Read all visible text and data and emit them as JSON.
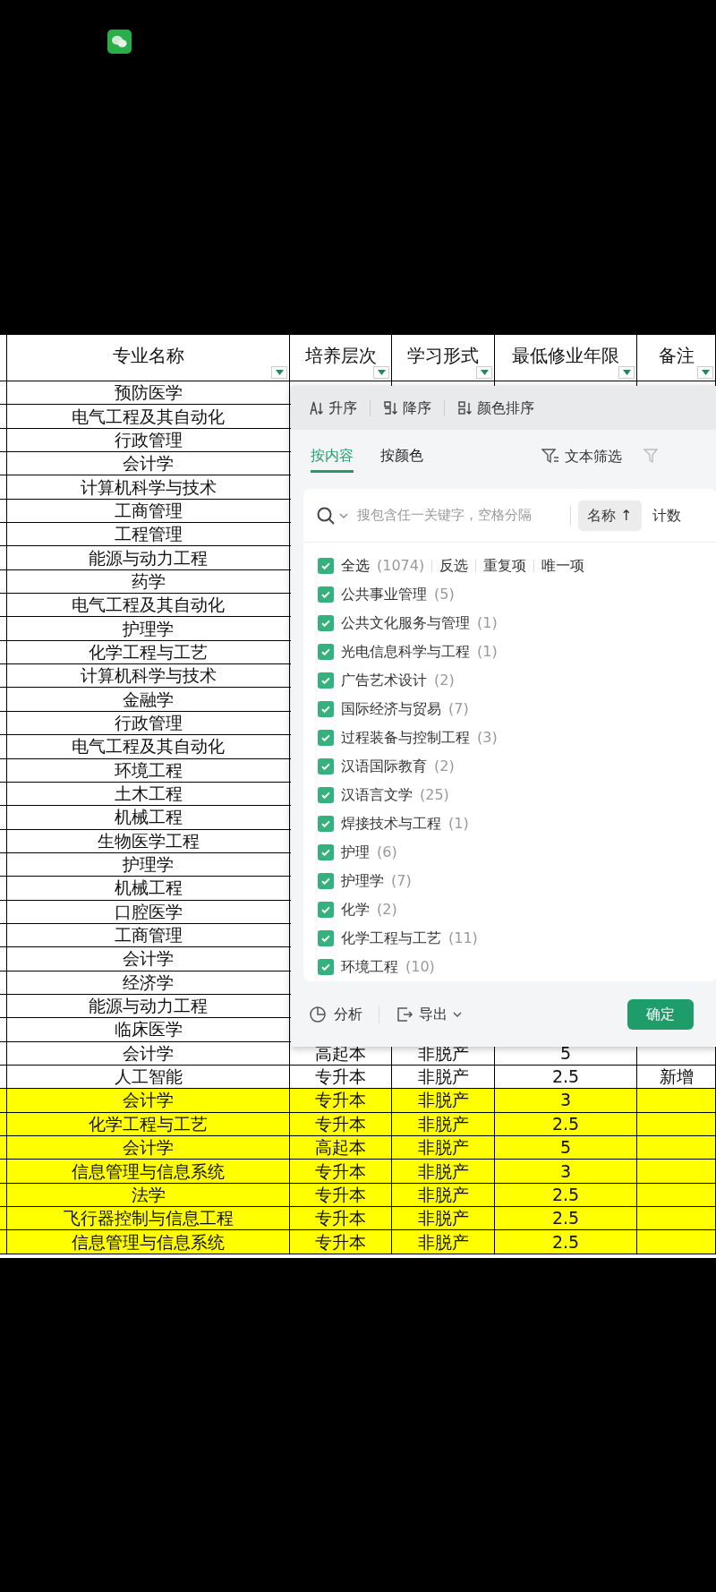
{
  "table": {
    "columns": [
      {
        "label": "专业名称"
      },
      {
        "label": "培养层次"
      },
      {
        "label": "学习形式"
      },
      {
        "label": "最低修业年限"
      },
      {
        "label": "备注"
      }
    ],
    "rows": [
      {
        "name": "预防医学",
        "highlighted": false
      },
      {
        "name": "电气工程及其自动化",
        "highlighted": false
      },
      {
        "name": "行政管理",
        "highlighted": false
      },
      {
        "name": "会计学",
        "highlighted": false
      },
      {
        "name": "计算机科学与技术",
        "highlighted": false
      },
      {
        "name": "工商管理",
        "highlighted": false
      },
      {
        "name": "工程管理",
        "highlighted": false
      },
      {
        "name": "能源与动力工程",
        "highlighted": false
      },
      {
        "name": "药学",
        "highlighted": false
      },
      {
        "name": "电气工程及其自动化",
        "highlighted": false
      },
      {
        "name": "护理学",
        "highlighted": false
      },
      {
        "name": "化学工程与工艺",
        "highlighted": false
      },
      {
        "name": "计算机科学与技术",
        "highlighted": false
      },
      {
        "name": "金融学",
        "highlighted": false
      },
      {
        "name": "行政管理",
        "highlighted": false
      },
      {
        "name": "电气工程及其自动化",
        "highlighted": false
      },
      {
        "name": "环境工程",
        "highlighted": false
      },
      {
        "name": "土木工程",
        "highlighted": false
      },
      {
        "name": "机械工程",
        "highlighted": false
      },
      {
        "name": "生物医学工程",
        "highlighted": false
      },
      {
        "name": "护理学",
        "highlighted": false
      },
      {
        "name": "机械工程",
        "highlighted": false
      },
      {
        "name": "口腔医学",
        "highlighted": false
      },
      {
        "name": "工商管理",
        "highlighted": false
      },
      {
        "name": "会计学",
        "highlighted": false
      },
      {
        "name": "经济学",
        "highlighted": false
      },
      {
        "name": "能源与动力工程",
        "highlighted": false
      },
      {
        "name": "临床医学",
        "highlighted": false
      },
      {
        "name": "会计学",
        "level": "高起本",
        "form": "非脱产",
        "years": "5",
        "highlighted": false
      },
      {
        "name": "人工智能",
        "level": "专升本",
        "form": "非脱产",
        "years": "2.5",
        "note": "新增",
        "highlighted": false
      },
      {
        "name": "会计学",
        "level": "专升本",
        "form": "非脱产",
        "years": "3",
        "highlighted": true
      },
      {
        "name": "化学工程与工艺",
        "level": "专升本",
        "form": "非脱产",
        "years": "2.5",
        "highlighted": true
      },
      {
        "name": "会计学",
        "level": "高起本",
        "form": "非脱产",
        "years": "5",
        "highlighted": true
      },
      {
        "name": "信息管理与信息系统",
        "level": "专升本",
        "form": "非脱产",
        "years": "3",
        "highlighted": true
      },
      {
        "name": "法学",
        "level": "专升本",
        "form": "非脱产",
        "years": "2.5",
        "highlighted": true
      },
      {
        "name": "飞行器控制与信息工程",
        "level": "专升本",
        "form": "非脱产",
        "years": "2.5",
        "highlighted": true
      },
      {
        "name": "信息管理与信息系统",
        "level": "专升本",
        "form": "非脱产",
        "years": "2.5",
        "highlighted": true
      }
    ]
  },
  "filter_popup": {
    "sort_buttons": [
      {
        "label": "升序",
        "kind": "asc"
      },
      {
        "label": "降序",
        "kind": "desc"
      },
      {
        "label": "颜色排序",
        "kind": "color"
      }
    ],
    "tabs": [
      {
        "label": "按内容",
        "selected": true
      },
      {
        "label": "按颜色",
        "selected": false
      }
    ],
    "text_filter": "文本筛选",
    "search": {
      "placeholder": "搜包含任一关键字，空格分隔"
    },
    "sort_by_name": "名称 ↑",
    "sort_by_count": "计数",
    "select_all": {
      "label": "全选",
      "count": "(1074)",
      "checked": true
    },
    "quick_actions": [
      "反选",
      "重复项",
      "唯一项"
    ],
    "items": [
      {
        "label": "公共事业管理",
        "count": "(5)",
        "checked": true
      },
      {
        "label": "公共文化服务与管理",
        "count": "(1)",
        "checked": true
      },
      {
        "label": "光电信息科学与工程",
        "count": "(1)",
        "checked": true
      },
      {
        "label": "广告艺术设计",
        "count": "(2)",
        "checked": true
      },
      {
        "label": "国际经济与贸易",
        "count": "(7)",
        "checked": true
      },
      {
        "label": "过程装备与控制工程",
        "count": "(3)",
        "checked": true
      },
      {
        "label": "汉语国际教育",
        "count": "(2)",
        "checked": true
      },
      {
        "label": "汉语言文学",
        "count": "(25)",
        "checked": true
      },
      {
        "label": "焊接技术与工程",
        "count": "(1)",
        "checked": true
      },
      {
        "label": "护理",
        "count": "(6)",
        "checked": true
      },
      {
        "label": "护理学",
        "count": "(7)",
        "checked": true
      },
      {
        "label": "化学",
        "count": "(2)",
        "checked": true
      },
      {
        "label": "化学工程与工艺",
        "count": "(11)",
        "checked": true
      },
      {
        "label": "环境工程",
        "count": "(10)",
        "checked": true
      }
    ],
    "analyze": "分析",
    "export": "导出",
    "confirm": "确定"
  }
}
